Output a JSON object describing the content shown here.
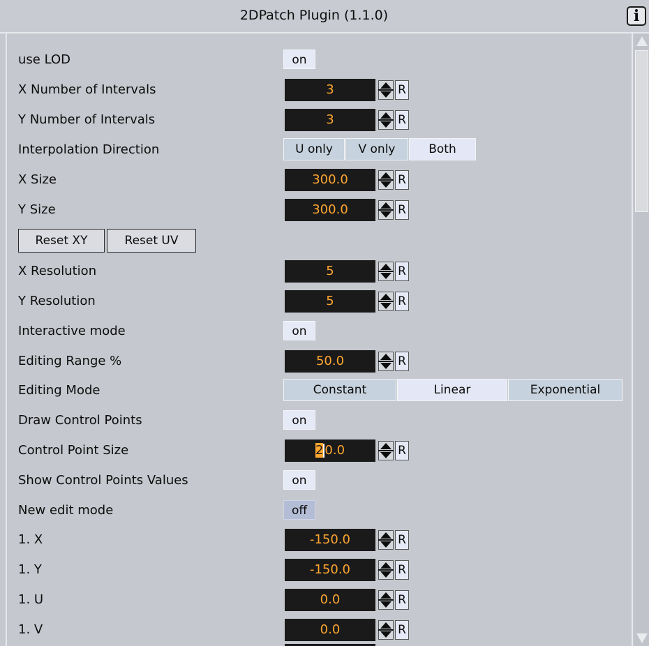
{
  "window": {
    "title": "2DPatch Plugin (1.1.0)",
    "info_icon": "info-icon",
    "info_glyph": "i"
  },
  "rows": {
    "use_lod": {
      "label": "use LOD",
      "value": "on"
    },
    "x_intervals": {
      "label": "X Number of Intervals",
      "value": "3",
      "reset": "R"
    },
    "y_intervals": {
      "label": "Y Number of Intervals",
      "value": "3",
      "reset": "R"
    },
    "interp_dir": {
      "label": "Interpolation Direction",
      "options": [
        "U only",
        "V only",
        "Both"
      ],
      "selected": "Both"
    },
    "x_size": {
      "label": "X Size",
      "value": "300.0",
      "reset": "R"
    },
    "y_size": {
      "label": "Y Size",
      "value": "300.0",
      "reset": "R"
    },
    "reset_buttons": {
      "reset_xy": "Reset XY",
      "reset_uv": "Reset UV"
    },
    "x_res": {
      "label": "X Resolution",
      "value": "5",
      "reset": "R"
    },
    "y_res": {
      "label": "Y Resolution",
      "value": "5",
      "reset": "R"
    },
    "interactive": {
      "label": "Interactive mode",
      "value": "on"
    },
    "edit_range": {
      "label": "Editing Range %",
      "value": "50.0",
      "reset": "R"
    },
    "edit_mode": {
      "label": "Editing Mode",
      "options": [
        "Constant",
        "Linear",
        "Exponential"
      ],
      "selected": "Linear"
    },
    "draw_cp": {
      "label": "Draw Control Points",
      "value": "on"
    },
    "cp_size": {
      "label": "Control Point Size",
      "value_selected": "2",
      "value_rest": "0.0",
      "reset": "R"
    },
    "show_cp_values": {
      "label": "Show Control Points Values",
      "value": "on"
    },
    "new_edit": {
      "label": "New edit mode",
      "value": "off"
    },
    "p1x": {
      "label": "1. X",
      "value": "-150.0",
      "reset": "R"
    },
    "p1y": {
      "label": "1. Y",
      "value": "-150.0",
      "reset": "R"
    },
    "p1u": {
      "label": "1. U",
      "value": "0.0",
      "reset": "R"
    },
    "p1v": {
      "label": "1. V",
      "value": "0.0",
      "reset": "R"
    }
  },
  "colors": {
    "panel_bg": "#c5c8ce",
    "field_bg": "#1a1a1a",
    "field_text": "#ffa631",
    "toggle_on": "#e6e9f6",
    "toggle_off": "#b4bdd6"
  }
}
